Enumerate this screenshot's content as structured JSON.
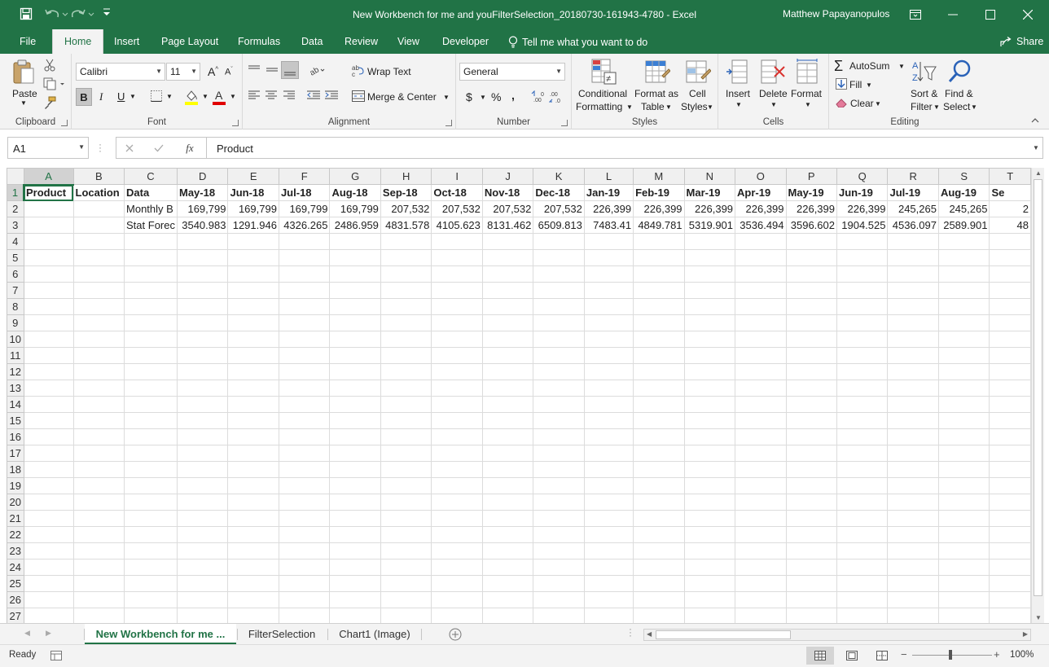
{
  "colors": {
    "accent": "#217346",
    "ribbon_bg": "#f3f3f3",
    "grid_line": "#dcdcdc"
  },
  "titlebar": {
    "title": "New Workbench for me and youFilterSelection_20180730-161943-4780  -  Excel",
    "user": "Matthew Papayanopulos"
  },
  "tabs": [
    "File",
    "Home",
    "Insert",
    "Page Layout",
    "Formulas",
    "Data",
    "Review",
    "View",
    "Developer"
  ],
  "tell_me": "Tell me what you want to do",
  "share": "Share",
  "ribbon": {
    "clipboard": {
      "label": "Clipboard",
      "paste": "Paste"
    },
    "font": {
      "label": "Font",
      "font_name": "Calibri",
      "font_size": "11",
      "bold": "B",
      "italic": "I",
      "underline": "U"
    },
    "alignment": {
      "label": "Alignment",
      "wrap_text": "Wrap Text",
      "merge_center": "Merge & Center"
    },
    "number": {
      "label": "Number",
      "format": "General",
      "currency": "$",
      "percent": "%",
      "comma": ","
    },
    "styles": {
      "label": "Styles",
      "conditional_1": "Conditional",
      "conditional_2": "Formatting",
      "format_table_1": "Format as",
      "format_table_2": "Table",
      "cell_styles_1": "Cell",
      "cell_styles_2": "Styles"
    },
    "cells": {
      "label": "Cells",
      "insert": "Insert",
      "delete": "Delete",
      "format": "Format"
    },
    "editing": {
      "label": "Editing",
      "autosum": "AutoSum",
      "fill": "Fill",
      "clear": "Clear",
      "sort_1": "Sort &",
      "sort_2": "Filter",
      "find_1": "Find &",
      "find_2": "Select"
    }
  },
  "formula_bar": {
    "name_box": "A1",
    "content": "Product"
  },
  "grid": {
    "columns": [
      "A",
      "B",
      "C",
      "D",
      "E",
      "F",
      "G",
      "H",
      "I",
      "J",
      "K",
      "L",
      "M",
      "N",
      "O",
      "P",
      "Q",
      "R",
      "S",
      "T"
    ],
    "rows": [
      [
        "Product",
        "Location",
        "Data",
        "May-18",
        "Jun-18",
        "Jul-18",
        "Aug-18",
        "Sep-18",
        "Oct-18",
        "Nov-18",
        "Dec-18",
        "Jan-19",
        "Feb-19",
        "Mar-19",
        "Apr-19",
        "May-19",
        "Jun-19",
        "Jul-19",
        "Aug-19",
        "Se"
      ],
      [
        "",
        "",
        "Monthly B",
        "169,799",
        "169,799",
        "169,799",
        "169,799",
        "207,532",
        "207,532",
        "207,532",
        "207,532",
        "226,399",
        "226,399",
        "226,399",
        "226,399",
        "226,399",
        "226,399",
        "245,265",
        "245,265",
        "2"
      ],
      [
        "",
        "",
        "Stat Forec",
        "3540.983",
        "1291.946",
        "4326.265",
        "2486.959",
        "4831.578",
        "4105.623",
        "8131.462",
        "6509.813",
        "7483.41",
        "4849.781",
        "5319.901",
        "3536.494",
        "3596.602",
        "1904.525",
        "4536.097",
        "2589.901",
        "48"
      ]
    ],
    "row_count": 27
  },
  "sheet_tabs": [
    "New Workbench for me ...",
    "FilterSelection",
    "Chart1 (Image)"
  ],
  "status": {
    "ready": "Ready",
    "zoom": "100%"
  }
}
